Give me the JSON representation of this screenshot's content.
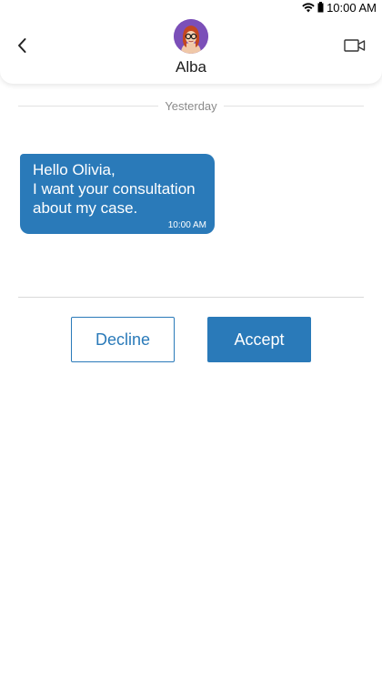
{
  "status_bar": {
    "time": "10:00 AM",
    "icons": [
      "wifi-icon",
      "battery-icon"
    ]
  },
  "header": {
    "back_icon": "chevron-left-icon",
    "contact_name": "Alba",
    "video_icon": "video-camera-icon"
  },
  "conversation": {
    "date_label": "Yesterday",
    "messages": [
      {
        "text": "Hello Olivia,\nI want your consultation about my case.",
        "time": "10:00 AM"
      }
    ]
  },
  "actions": {
    "decline_label": "Decline",
    "accept_label": "Accept"
  },
  "colors": {
    "accent": "#2a7ab9",
    "divider": "#e2e2e2",
    "muted_text": "#8a8a8a"
  }
}
